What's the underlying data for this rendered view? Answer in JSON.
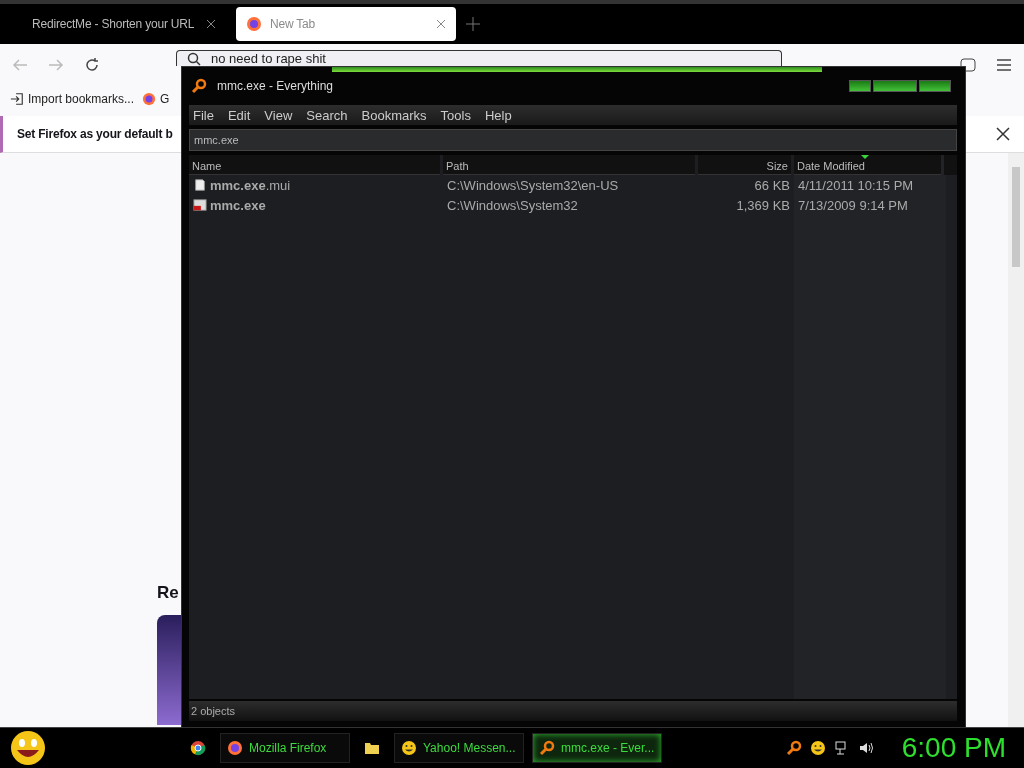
{
  "browser": {
    "tabs": [
      {
        "label": "RedirectMe - Shorten your URL",
        "selected": false
      },
      {
        "label": "New Tab",
        "selected": true
      }
    ],
    "address": {
      "value": "no need to rape shit"
    },
    "bookmarks": [
      {
        "label": "Import bookmarks...",
        "kind": "import"
      },
      {
        "label": "G",
        "kind": "firefox"
      }
    ],
    "notification": {
      "text": "Set Firefox as your default b"
    },
    "content": {
      "heading": "Re"
    }
  },
  "everything": {
    "title": "mmc.exe - Everything",
    "menu": [
      "File",
      "Edit",
      "View",
      "Search",
      "Bookmarks",
      "Tools",
      "Help"
    ],
    "search": {
      "value": "mmc.exe"
    },
    "columns": [
      {
        "label": "Name",
        "sorted": false,
        "kind": "text"
      },
      {
        "label": "Path",
        "sorted": false,
        "kind": "text"
      },
      {
        "label": "Size",
        "sorted": false,
        "kind": "number"
      },
      {
        "label": "Date Modified",
        "sorted": true,
        "kind": "text"
      }
    ],
    "rows": [
      {
        "name": "mmc.exe",
        "ext": ".mui",
        "path": "C:\\Windows\\System32\\en-US",
        "size": "66 KB",
        "modified": "4/11/2011 10:15 PM",
        "kind": "document"
      },
      {
        "name": "mmc.exe",
        "path": "C:\\Windows\\System32",
        "size": "1,369 KB",
        "modified": "7/13/2009 9:14 PM",
        "kind": "program"
      }
    ],
    "status": "2 objects"
  },
  "taskbar": {
    "items": [
      {
        "kind": "chrome",
        "selected": false
      },
      {
        "kind": "firefox",
        "label": "Mozilla Firefox",
        "selected": false
      },
      {
        "kind": "folder",
        "selected": false
      },
      {
        "kind": "messenger",
        "label": "Yahoo! Messen...",
        "selected": false
      },
      {
        "kind": "search",
        "label": "mmc.exe - Ever...",
        "selected": true
      }
    ],
    "tray": [
      {
        "kind": "search"
      },
      {
        "kind": "messenger"
      },
      {
        "kind": "network"
      },
      {
        "kind": "volume"
      }
    ],
    "clock": "6:00 PM"
  }
}
